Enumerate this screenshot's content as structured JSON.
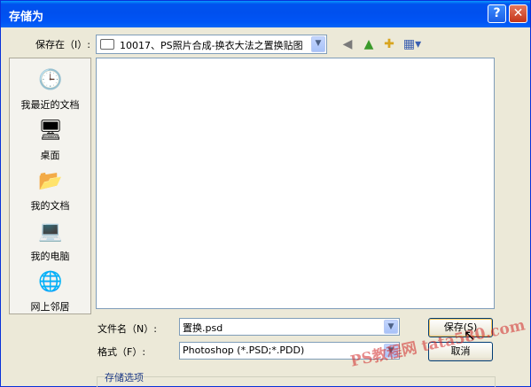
{
  "window": {
    "title": "存储为",
    "help_icon": "?",
    "close_icon": "✕"
  },
  "lookin": {
    "label": "保存在（I）:",
    "folder": "10017、PS照片合成-换衣大法之置换贴图"
  },
  "places": [
    {
      "label": "我最近的文档",
      "icon": "recent-documents-icon"
    },
    {
      "label": "桌面",
      "icon": "desktop-icon"
    },
    {
      "label": "我的文档",
      "icon": "my-documents-icon"
    },
    {
      "label": "我的电脑",
      "icon": "my-computer-icon"
    },
    {
      "label": "网上邻居",
      "icon": "network-places-icon"
    }
  ],
  "filename": {
    "label": "文件名（N）:",
    "value": "置换.psd"
  },
  "format": {
    "label": "格式（F）:",
    "value": "Photoshop (*.PSD;*.PDD)"
  },
  "buttons": {
    "save": "保存(S)",
    "cancel": "取消"
  },
  "options": {
    "label": "存储选项"
  },
  "watermark": "PS教程网 tata580.com",
  "colors": {
    "titlebar": "#0054e3",
    "dialog_bg": "#ece9d8"
  }
}
